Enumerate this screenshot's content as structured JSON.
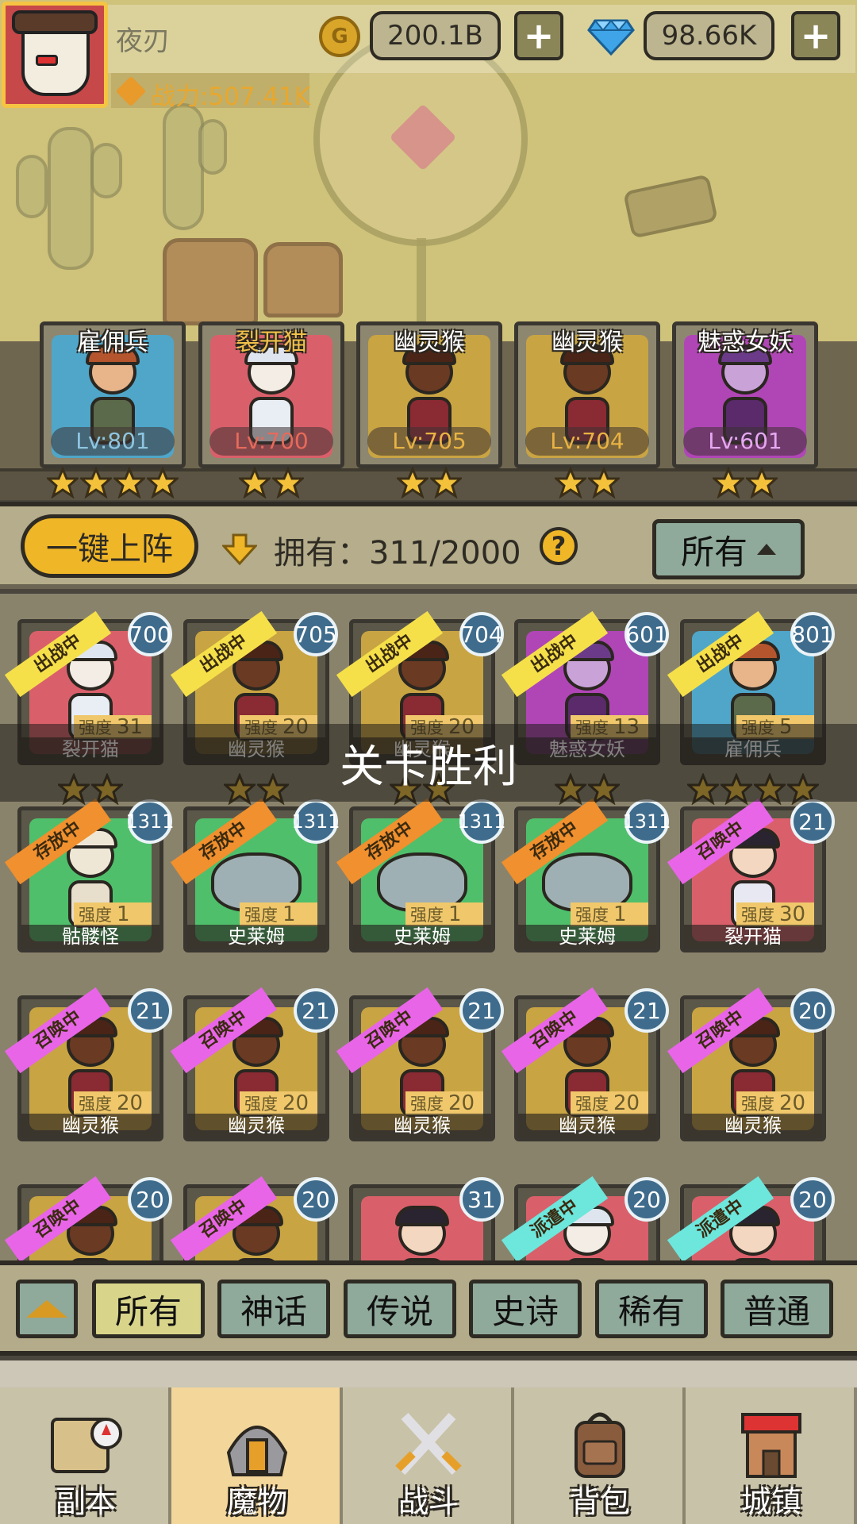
{
  "player": {
    "name": "夜刃",
    "power": "战力:507.41K"
  },
  "resources": {
    "coins": "200.1B",
    "gems": "98.66K",
    "plus": "+"
  },
  "team": [
    {
      "name": "雇佣兵",
      "level": "Lv:801",
      "stars": 4,
      "name_color": "#ffffff",
      "lv_color": "#8ec5e0",
      "bg": "#4fa6c9",
      "hero": "mercenary"
    },
    {
      "name": "裂开猫",
      "level": "Lv:700",
      "stars": 2,
      "name_color": "#f2c14a",
      "lv_color": "#e76a5a",
      "bg": "#d9606a",
      "hero": "cat"
    },
    {
      "name": "幽灵猴",
      "level": "Lv:705",
      "stars": 2,
      "name_color": "#ffffff",
      "lv_color": "#e9b344",
      "bg": "#c9a443",
      "hero": "monkey"
    },
    {
      "name": "幽灵猴",
      "level": "Lv:704",
      "stars": 2,
      "name_color": "#ffffff",
      "lv_color": "#e9b344",
      "bg": "#c9a443",
      "hero": "monkey"
    },
    {
      "name": "魅惑女妖",
      "level": "Lv:601",
      "stars": 2,
      "name_color": "#ffffff",
      "lv_color": "#e5a8f0",
      "bg": "#b046b6",
      "hero": "succubus"
    }
  ],
  "roster_header": {
    "one_key": "一键上阵",
    "owned": "拥有：311/2000",
    "help": "?",
    "filter": "所有"
  },
  "victory": "关卡胜利",
  "strength_label": "强度",
  "cards": [
    {
      "name": "裂开猫",
      "badge": "700",
      "ribbon": "出战中",
      "strength": "31",
      "bg": "#d9606a",
      "hero": "cat",
      "stars": 2
    },
    {
      "name": "幽灵猴",
      "badge": "705",
      "ribbon": "出战中",
      "strength": "20",
      "bg": "#c9a443",
      "hero": "monkey",
      "stars": 2
    },
    {
      "name": "幽灵猴",
      "badge": "704",
      "ribbon": "出战中",
      "strength": "20",
      "bg": "#c9a443",
      "hero": "monkey",
      "stars": 2
    },
    {
      "name": "魅惑女妖",
      "badge": "601",
      "ribbon": "出战中",
      "strength": "13",
      "bg": "#b046b6",
      "hero": "succubus",
      "stars": 2
    },
    {
      "name": "雇佣兵",
      "badge": "801",
      "ribbon": "出战中",
      "strength": "5",
      "bg": "#4fa6c9",
      "hero": "mercenary",
      "stars": 4
    },
    {
      "name": "骷髅怪",
      "badge": "1311",
      "ribbon": "存放中",
      "strength": "1",
      "bg": "#4fbf6b",
      "hero": "skeleton",
      "stars": 0
    },
    {
      "name": "史莱姆",
      "badge": "1311",
      "ribbon": "存放中",
      "strength": "1",
      "bg": "#4fbf6b",
      "hero": "slime",
      "stars": 0
    },
    {
      "name": "史莱姆",
      "badge": "1311",
      "ribbon": "存放中",
      "strength": "1",
      "bg": "#4fbf6b",
      "hero": "slime",
      "stars": 0
    },
    {
      "name": "史莱姆",
      "badge": "1311",
      "ribbon": "存放中",
      "strength": "1",
      "bg": "#4fbf6b",
      "hero": "slime",
      "stars": 0
    },
    {
      "name": "裂开猫",
      "badge": "21",
      "ribbon": "召唤中",
      "strength": "30",
      "bg": "#d9606a",
      "hero": "catgirl",
      "stars": 0
    },
    {
      "name": "幽灵猴",
      "badge": "21",
      "ribbon": "召唤中",
      "strength": "20",
      "bg": "#c9a443",
      "hero": "monkey",
      "stars": 0
    },
    {
      "name": "幽灵猴",
      "badge": "21",
      "ribbon": "召唤中",
      "strength": "20",
      "bg": "#c9a443",
      "hero": "monkey",
      "stars": 0
    },
    {
      "name": "幽灵猴",
      "badge": "21",
      "ribbon": "召唤中",
      "strength": "20",
      "bg": "#c9a443",
      "hero": "monkey",
      "stars": 0
    },
    {
      "name": "幽灵猴",
      "badge": "21",
      "ribbon": "召唤中",
      "strength": "20",
      "bg": "#c9a443",
      "hero": "monkey",
      "stars": 0
    },
    {
      "name": "幽灵猴",
      "badge": "20",
      "ribbon": "召唤中",
      "strength": "20",
      "bg": "#c9a443",
      "hero": "monkey",
      "stars": 0
    },
    {
      "name": "",
      "badge": "20",
      "ribbon": "召唤中",
      "strength": "",
      "bg": "#c9a443",
      "hero": "monkey",
      "stars": 0
    },
    {
      "name": "",
      "badge": "20",
      "ribbon": "召唤中",
      "strength": "",
      "bg": "#c9a443",
      "hero": "monkey",
      "stars": 0
    },
    {
      "name": "",
      "badge": "31",
      "ribbon": "",
      "strength": "",
      "bg": "#d9606a",
      "hero": "catgirl",
      "stars": 0
    },
    {
      "name": "",
      "badge": "20",
      "ribbon": "派遣中",
      "strength": "",
      "bg": "#d9606a",
      "hero": "cat",
      "stars": 0
    },
    {
      "name": "",
      "badge": "20",
      "ribbon": "派遣中",
      "strength": "",
      "bg": "#d9606a",
      "hero": "catgirl",
      "stars": 0
    }
  ],
  "ribbon_colors": {
    "出战中": "#f5e04a",
    "存放中": "#f0902e",
    "召唤中": "#e865e8",
    "派遣中": "#6de6dc"
  },
  "rarity_tabs": [
    {
      "label": "所有",
      "active": true
    },
    {
      "label": "神话",
      "active": false
    },
    {
      "label": "传说",
      "active": false
    },
    {
      "label": "史诗",
      "active": false
    },
    {
      "label": "稀有",
      "active": false
    },
    {
      "label": "普通",
      "active": false
    }
  ],
  "nav": [
    {
      "label": "副本",
      "icon": "map-icon",
      "active": false
    },
    {
      "label": "魔物",
      "icon": "monster-helmet-icon",
      "active": true
    },
    {
      "label": "战斗",
      "icon": "crossed-swords-icon",
      "active": false
    },
    {
      "label": "背包",
      "icon": "backpack-icon",
      "active": false
    },
    {
      "label": "城镇",
      "icon": "shop-icon",
      "active": false
    }
  ]
}
